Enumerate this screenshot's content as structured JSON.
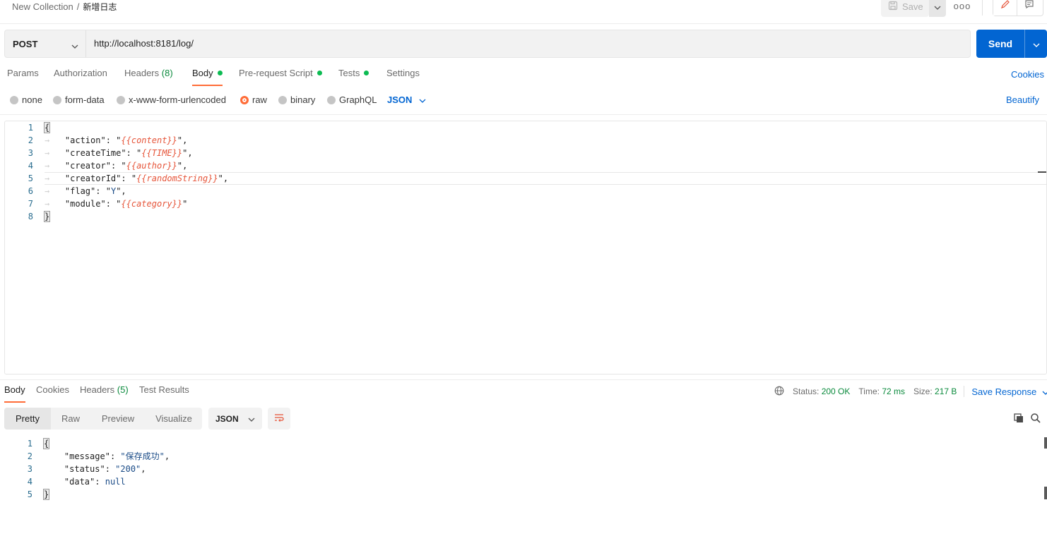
{
  "breadcrumb": {
    "collection": "New Collection",
    "separator": "/",
    "request": "新增日志"
  },
  "toolbar": {
    "save_label": "Save",
    "more_label": "ooo"
  },
  "request": {
    "method": "POST",
    "url": "http://localhost:8181/log/",
    "send_label": "Send"
  },
  "request_tabs": [
    {
      "label": "Params"
    },
    {
      "label": "Authorization"
    },
    {
      "label": "Headers",
      "count": "(8)"
    },
    {
      "label": "Body"
    },
    {
      "label": "Pre-request Script"
    },
    {
      "label": "Tests"
    },
    {
      "label": "Settings"
    }
  ],
  "cookies_label": "Cookies",
  "body_types": [
    "none",
    "form-data",
    "x-www-form-urlencoded",
    "raw",
    "binary",
    "GraphQL"
  ],
  "selected_body_type": "raw",
  "language": "JSON",
  "beautify_label": "Beautify",
  "request_body": {
    "line_numbers": [
      "1",
      "2",
      "3",
      "4",
      "5",
      "6",
      "7",
      "8"
    ],
    "open_brace": "{",
    "close_brace": "}",
    "fields": [
      {
        "key": "\"action\"",
        "value": "{{content}}",
        "variable": true,
        "trail": ","
      },
      {
        "key": "\"createTime\"",
        "value": "{{TIME}}",
        "variable": true,
        "trail": ","
      },
      {
        "key": "\"creator\"",
        "value": "{{author}}",
        "variable": true,
        "trail": ","
      },
      {
        "key": "\"creatorId\"",
        "value": "{{randomString}}",
        "variable": true,
        "trail": ","
      },
      {
        "key": "\"flag\"",
        "value": "Y",
        "variable": false,
        "trail": ","
      },
      {
        "key": "\"module\"",
        "value": "{{category}}",
        "variable": true,
        "trail": ""
      }
    ]
  },
  "response_tabs": [
    {
      "label": "Body"
    },
    {
      "label": "Cookies"
    },
    {
      "label": "Headers",
      "count": "(5)"
    },
    {
      "label": "Test Results"
    }
  ],
  "response_meta": {
    "status_label": "Status:",
    "status_value": "200 OK",
    "time_label": "Time:",
    "time_value": "72 ms",
    "size_label": "Size:",
    "size_value": "217 B",
    "save_response_label": "Save Response"
  },
  "response_views": [
    "Pretty",
    "Raw",
    "Preview",
    "Visualize"
  ],
  "response_format": "JSON",
  "response_body": {
    "line_numbers": [
      "1",
      "2",
      "3",
      "4",
      "5"
    ],
    "open_brace": "{",
    "close_brace": "}",
    "l2_key": "\"message\"",
    "l2_val": "\"保存成功\"",
    "l3_key": "\"status\"",
    "l3_val": "\"200\"",
    "l4_key": "\"data\"",
    "l4_val": "null"
  },
  "colors": {
    "accent": "#ff6c37",
    "link": "#0265d2",
    "send": "#0265d2",
    "success": "#0cbb52"
  }
}
